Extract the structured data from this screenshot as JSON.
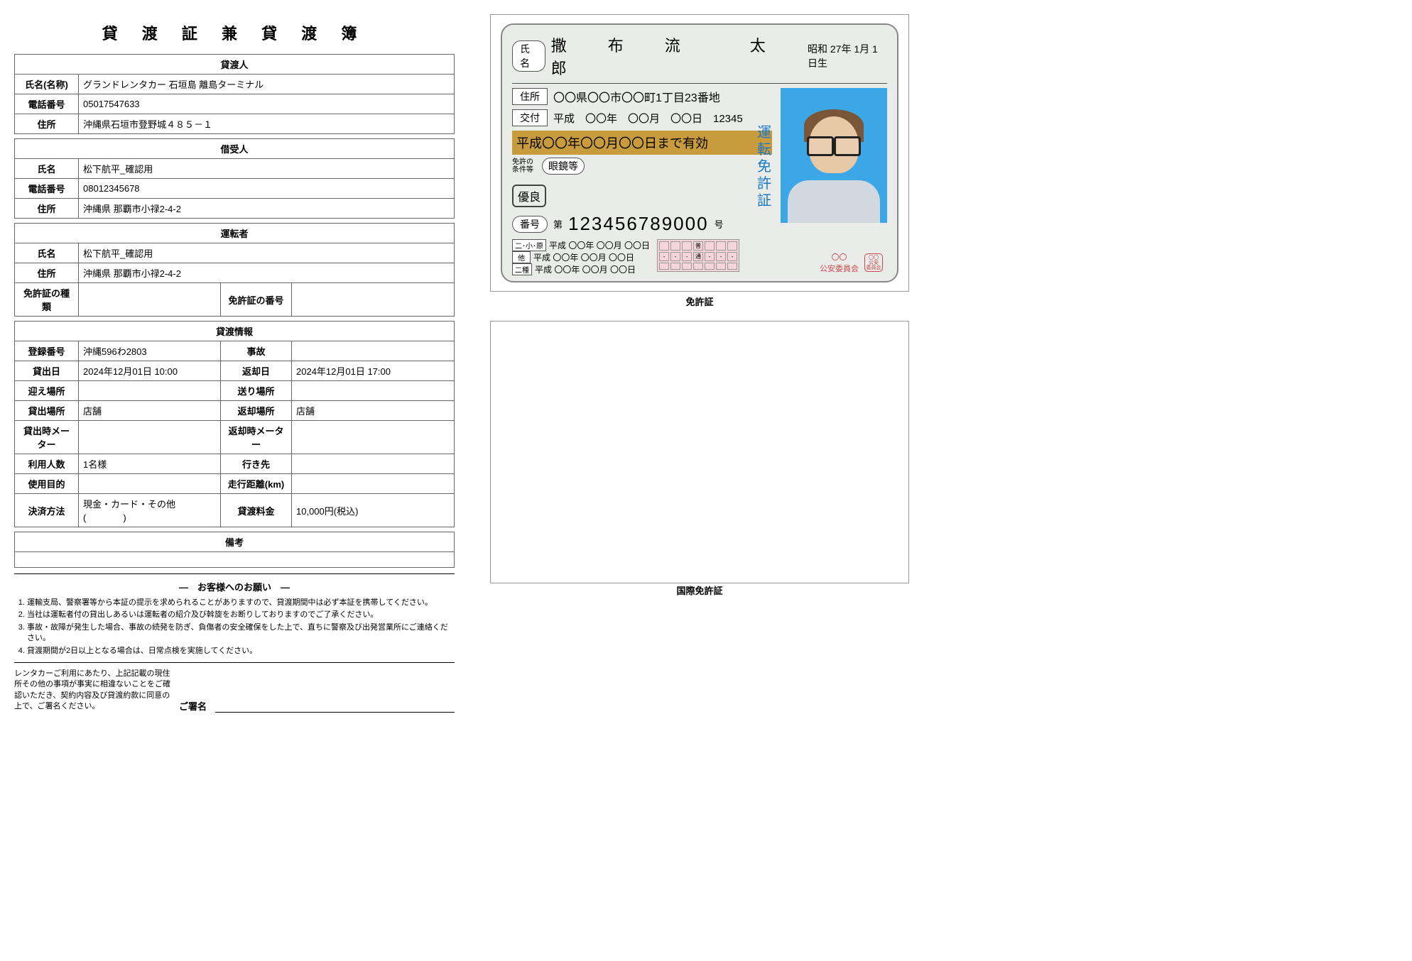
{
  "title": "貸 渡 証 兼 貸 渡 簿",
  "lender": {
    "section": "貸渡人",
    "name_label": "氏名(名称)",
    "name": "グランドレンタカー 石垣島 離島ターミナル",
    "tel_label": "電話番号",
    "tel": "05017547633",
    "addr_label": "住所",
    "addr": "沖縄県石垣市登野城４８５－１"
  },
  "borrower": {
    "section": "借受人",
    "name_label": "氏名",
    "name": "松下航平_確認用",
    "tel_label": "電話番号",
    "tel": "08012345678",
    "addr_label": "住所",
    "addr": "沖縄県 那覇市小禄2-4-2"
  },
  "driver": {
    "section": "運転者",
    "name_label": "氏名",
    "name": "松下航平_確認用",
    "addr_label": "住所",
    "addr": "沖縄県 那覇市小禄2-4-2",
    "lic_type_label": "免許証の種類",
    "lic_type": "",
    "lic_no_label": "免許証の番号",
    "lic_no": ""
  },
  "rental": {
    "section": "貸渡情報",
    "reg_label": "登録番号",
    "reg": "沖縄596わ2803",
    "accident_label": "事故",
    "accident": "",
    "out_date_label": "貸出日",
    "out_date": "2024年12月01日  10:00",
    "ret_date_label": "返却日",
    "ret_date": "2024年12月01日  17:00",
    "pickup_label": "迎え場所",
    "pickup": "",
    "dropoff_label": "送り場所",
    "dropoff": "",
    "out_loc_label": "貸出場所",
    "out_loc": "店舗",
    "ret_loc_label": "返却場所",
    "ret_loc": "店舗",
    "out_meter_label": "貸出時メーター",
    "out_meter": "",
    "ret_meter_label": "返却時メーター",
    "ret_meter": "",
    "pax_label": "利用人数",
    "pax": "1名様",
    "dest_label": "行き先",
    "dest": "",
    "purpose_label": "使用目的",
    "purpose": "",
    "dist_label": "走行距離(km)",
    "dist": "",
    "pay_label": "決済方法",
    "pay": "現金・カード・その他(　　　　)",
    "fee_label": "貸渡料金",
    "fee": "10,000円(税込)"
  },
  "notes_label": "備考",
  "request": {
    "title": "―　お客様へのお願い　―",
    "items": [
      "運輸支局、警察署等から本証の提示を求められることがありますので、貸渡期間中は必ず本証を携帯してください。",
      "当社は運転者付の貸出しあるいは運転者の紹介及び斡旋をお断りしておりますのでご了承ください。",
      "事故・故障が発生した場合、事故の続発を防ぎ、負傷者の安全確保をした上で、直ちに警察及び出発営業所にご連絡ください。",
      "貸渡期間が2日以上となる場合は、日常点検を実施してください。"
    ]
  },
  "signature": {
    "text": "レンタカーご利用にあたり、上記記載の現住所その他の事項が事実に相違ないことをご確認いただき、契約内容及び貸渡約款に同意の上で、ご署名ください。",
    "label": "ご署名"
  },
  "license_caption": "免許証",
  "intl_caption": "国際免許証",
  "license": {
    "name_label": "氏名",
    "name": "撒　布　流　　太　郎",
    "birth": "昭和  27年   1月   1日生",
    "addr_label": "住所",
    "addr": "〇〇県〇〇市〇〇町1丁目23番地",
    "issue_label": "交付",
    "issue": "平成　〇〇年　〇〇月　〇〇日　12345",
    "valid": "平成〇〇年〇〇月〇〇日まで有効",
    "cond_label": "免許の\n条件等",
    "cond": "眼鏡等",
    "rank": "優良",
    "num_label": "番号",
    "num_prefix": "第",
    "num": "123456789000",
    "num_suffix": "号",
    "side": "運転免許証",
    "dates": [
      {
        "lbl": "二･小･原",
        "val": "平成  〇〇年  〇〇月  〇〇日"
      },
      {
        "lbl": "他",
        "val": "平成  〇〇年  〇〇月  〇〇日"
      },
      {
        "lbl": "二種",
        "val": "平成  〇〇年  〇〇月  〇〇日"
      }
    ],
    "committee_mark": "〇〇",
    "committee": "公安委員会",
    "stamp": "〇〇\n公安\n委員会"
  }
}
